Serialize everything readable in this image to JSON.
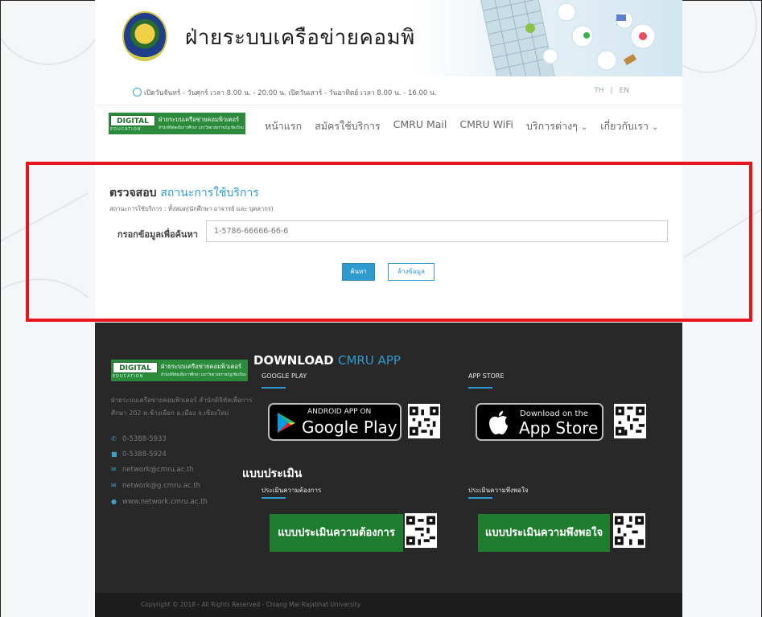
{
  "header": {
    "site_title": "ฝ่ายระบบเครือข่ายคอมพิวเตอร์",
    "hours": "เปิดวันจันทร์ - วันศุกร์ เวลา 8.00 น. - 20.00 น. เปิดวันเสาร์ - วันอาทิตย์ เวลา 8.00 น. - 16.00 น.",
    "lang": [
      "TH",
      "|",
      "EN"
    ]
  },
  "nav": {
    "logo_badge": "DIGITAL",
    "logo_badge_sub": "EDUCATION",
    "logo_text": "ฝ่ายระบบเครือข่ายคอมพิวเตอร์",
    "logo_subtext": "สำนักดิจิทัลเพื่อการศึกษา มหาวิทยาลัยราชภัฏเชียงใหม่",
    "items": [
      "หน้าแรก",
      "สมัครใช้บริการ",
      "CMRU Mail",
      "CMRU WiFi",
      "บริการต่างๆ",
      "เกี่ยวกับเรา"
    ],
    "dropdown_marker": "⌄"
  },
  "search_panel": {
    "title_part1": "ตรวจสอบ",
    "title_part2": "สถานะการใช้บริการ",
    "subtitle": "สถานะการใช้บริการ : ทั้งหมด(นักศึกษา อาจารย์ และ บุคลากร)",
    "field_label": "กรอกข้อมูลเพื่อค้นหา",
    "field_value": "1-5786-66666-66-6",
    "search_button": "ค้นหา",
    "clear_button": "ล้างข้อมูล"
  },
  "footer": {
    "address": "ฝ่ายระบบเครือข่ายคอมพิวเตอร์ สำนักดิจิทัลเพื่อการศึกษา 202 ต.ช้างเผือก อ.เมือง จ.เชียงใหม่",
    "phone": "0-5388-5933",
    "fax": "0-5388-5924",
    "email1": "network@cmru.ac.th",
    "email2": "network@g.cmru.ac.th",
    "website": "www.network.cmru.ac.th",
    "download_title_part1": "DOWNLOAD",
    "download_title_part2": "CMRU APP",
    "google_play_head": "GOOGLE PLAY",
    "app_store_head": "APP STORE",
    "google_badge_small": "ANDROID APP ON",
    "google_badge_big": "Google Play",
    "apple_badge_small": "Download on the",
    "apple_badge_big": "App Store",
    "eval_title": "แบบประเมิน",
    "eval_need_head": "ประเมินความต้องการ",
    "eval_satisfaction_head": "ประเมินความพึงพอใจ",
    "eval_need_button": "แบบประเมินความต้องการ",
    "eval_satisfaction_button": "แบบประเมินความพึงพอใจ",
    "copyright": "Copyright © 2018 - All Rights Reserved - Chiang Mai Rajabhat University"
  },
  "colors": {
    "accent_blue": "#2f9ad0",
    "brand_green": "#2b8b3b",
    "highlight_red": "#e8141b",
    "footer_bg": "#282828"
  }
}
